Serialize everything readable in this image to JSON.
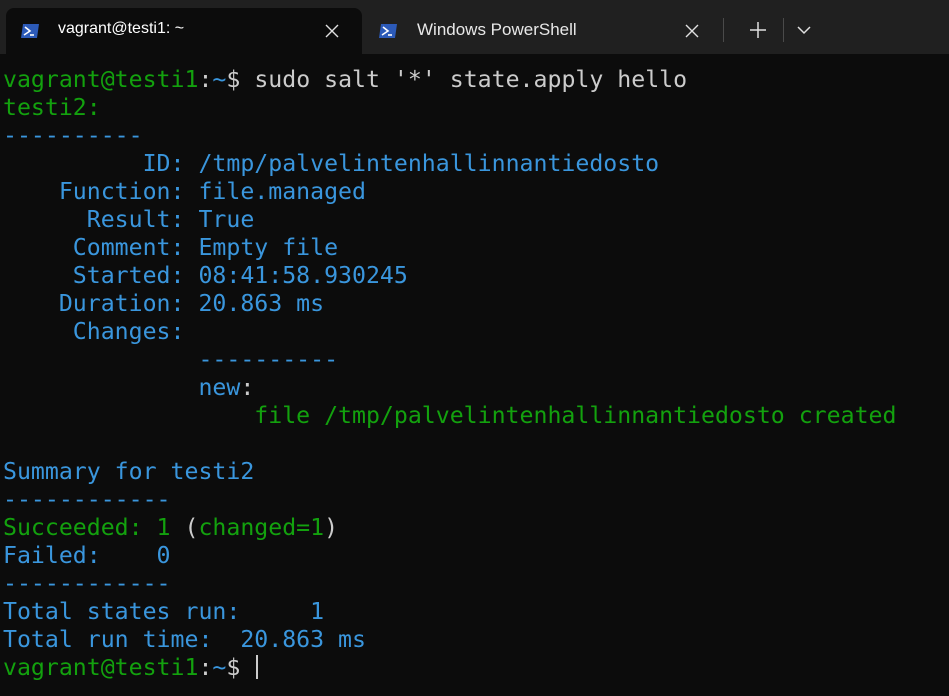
{
  "tabs": [
    {
      "title": "vagrant@testi1: ~",
      "icon": "powershell-icon",
      "active": true
    },
    {
      "title": "Windows PowerShell",
      "icon": "powershell-icon",
      "active": false
    }
  ],
  "colors": {
    "green": "#13a10e",
    "blue": "#3a96dd",
    "white": "#cccccc",
    "background": "#0c0c0c",
    "tabbar": "#202020"
  },
  "terminal": {
    "prompt_user_host": "vagrant@testi1",
    "prompt_colon": ":",
    "prompt_path": "~",
    "prompt_dollar": "$",
    "command": " sudo salt '*' state.apply hello",
    "minion": "testi2:",
    "sep1": "----------",
    "id_key": "          ID:",
    "id_val": " /tmp/palvelintenhallinnantiedosto",
    "function_key": "    Function:",
    "function_val": " file.managed",
    "result_key": "      Result:",
    "result_val": " True",
    "comment_key": "     Comment:",
    "comment_val": " Empty file",
    "started_key": "     Started:",
    "started_val": " 08:41:58.930245",
    "duration_key": "    Duration:",
    "duration_val": " 20.863 ms",
    "changes_key": "     Changes:",
    "changes_sep": "              ----------",
    "new_key": "              new",
    "new_colon": ":",
    "new_val": "                  file /tmp/palvelintenhallinnantiedosto created",
    "summary_title": "Summary for testi2",
    "summary_sep": "------------",
    "succeeded_label": "Succeeded: 1",
    "succeeded_paren_open": " (",
    "succeeded_changed": "changed=1",
    "succeeded_paren_close": ")",
    "failed_label": "Failed:    0",
    "summary_sep2": "------------",
    "total_states": "Total states run:     1",
    "total_time": "Total run time:  20.863 ms",
    "final_prompt_user_host": "vagrant@testi1",
    "final_prompt_colon": ":",
    "final_prompt_path": "~",
    "final_prompt_dollar": "$ "
  }
}
